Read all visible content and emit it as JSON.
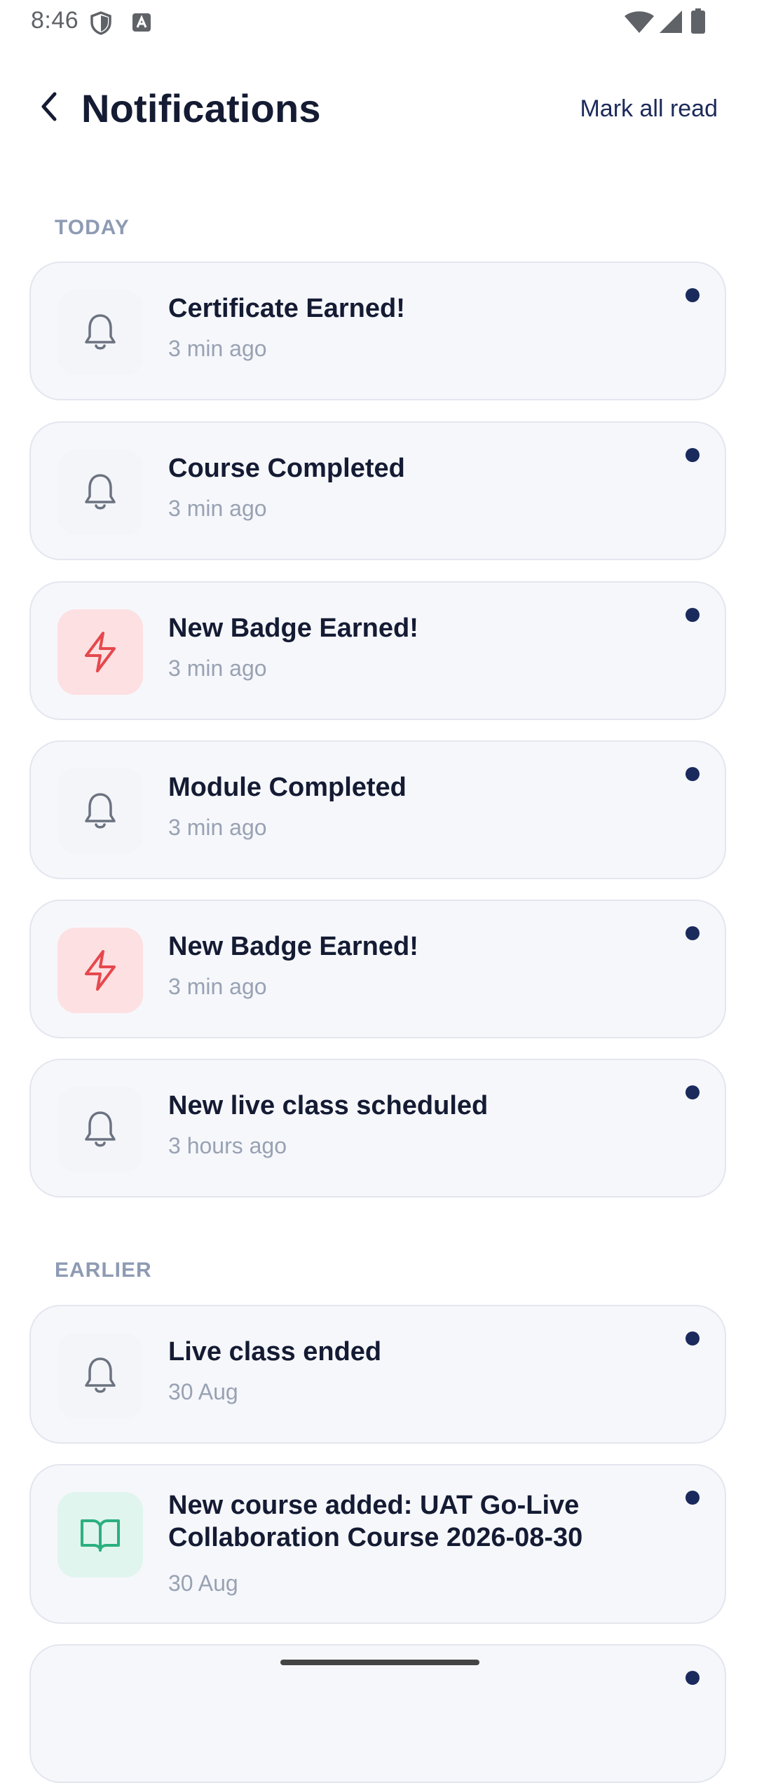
{
  "status_bar": {
    "time": "8:46",
    "icons": [
      "shield-icon",
      "app-notification-icon",
      "wifi-icon",
      "signal-icon",
      "battery-icon"
    ]
  },
  "header": {
    "back_icon": "chevron-left-icon",
    "title": "Notifications",
    "mark_all_label": "Mark all read"
  },
  "sections": {
    "today_label": "TODAY",
    "earlier_label": "EARLIER"
  },
  "notifications": [
    {
      "title": "Certificate Earned!",
      "time": "3 min ago",
      "icon": "bell-icon",
      "unread": true
    },
    {
      "title": "Course Completed",
      "time": "3 min ago",
      "icon": "bell-icon",
      "unread": true
    },
    {
      "title": "New Badge Earned!",
      "time": "3 min ago",
      "icon": "lightning-icon",
      "unread": true
    },
    {
      "title": "Module Completed",
      "time": "3 min ago",
      "icon": "bell-icon",
      "unread": true
    },
    {
      "title": "New Badge Earned!",
      "time": "3 min ago",
      "icon": "lightning-icon",
      "unread": true
    },
    {
      "title": "New live class scheduled",
      "time": "3 hours ago",
      "icon": "bell-icon",
      "unread": true
    },
    {
      "title": "Live class ended",
      "time": "30 Aug",
      "icon": "bell-icon",
      "unread": true
    },
    {
      "title": "New course added: UAT Go-Live Collaboration Course 2026-08-30",
      "time": "30 Aug",
      "icon": "book-icon",
      "unread": true
    },
    {
      "title": "",
      "time": "",
      "icon": "",
      "unread": true
    }
  ],
  "colors": {
    "accent": "#1a2a5c",
    "badge_red": "#e5484d",
    "book_green": "#2bb07f",
    "muted_text": "#98a2b3"
  }
}
